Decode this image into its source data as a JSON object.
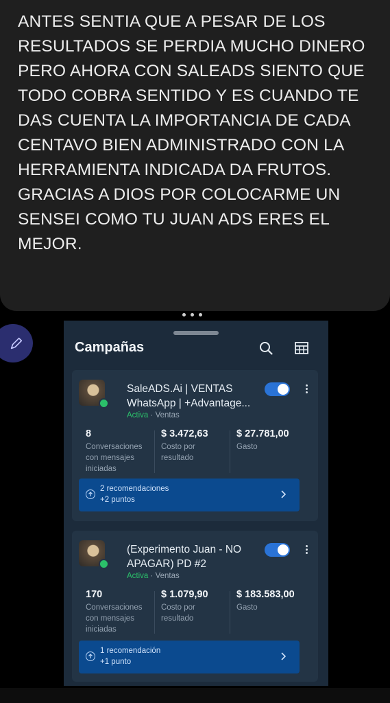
{
  "story": {
    "text": "ANTES SENTIA QUE A PESAR DE LOS\nRESULTADOS SE PERDIA MUCHO DINERO\nPERO AHORA CON SALEADS SIENTO QUE\nTODO COBRA SENTIDO Y ES CUANDO TE\nDAS CUENTA LA IMPORTANCIA DE CADA\nCENTAVO BIEN ADMINISTRADO CON LA\nHERRAMIENTA INDICADA DA FRUTOS.\nGRACIAS A DIOS POR COLOCARME UN\nSENSEI COMO TU JUAN ADS ERES EL\nMEJOR.",
    "background": "#1f1f1f"
  },
  "panel": {
    "title": "Campañas",
    "search_icon": "search-icon",
    "table_icon": "table-icon",
    "edit_icon": "pencil-icon"
  },
  "campaigns": [
    {
      "name": "SaleADS.Ai | VENTAS WhatsApp | +Advantage...",
      "status": "Activa",
      "objective": "Ventas",
      "toggle_on": true,
      "metrics": [
        {
          "value": "8",
          "label": "Conversaciones\ncon mensajes\niniciadas"
        },
        {
          "value": "$ 3.472,63",
          "label": "Costo por\nresultado"
        },
        {
          "value": "$ 27.781,00",
          "label": "Gasto"
        }
      ],
      "recommendation": {
        "title": "2 recomendaciones",
        "points": "+2 puntos"
      }
    },
    {
      "name": "(Experimento Juan - NO APAGAR) PD #2",
      "status": "Activa",
      "objective": "Ventas",
      "toggle_on": true,
      "metrics": [
        {
          "value": "170",
          "label": "Conversaciones\ncon mensajes\niniciadas"
        },
        {
          "value": "$ 1.079,90",
          "label": "Costo por\nresultado"
        },
        {
          "value": "$ 183.583,00",
          "label": "Gasto"
        }
      ],
      "recommendation": {
        "title": "1 recomendación",
        "points": "+1 punto"
      }
    }
  ],
  "colors": {
    "panel_bg": "#1c2b3b",
    "card_bg": "#233445",
    "accent_blue": "#2a73d6",
    "reco_bg": "#0b4a8f",
    "active_green": "#2bc06a"
  }
}
